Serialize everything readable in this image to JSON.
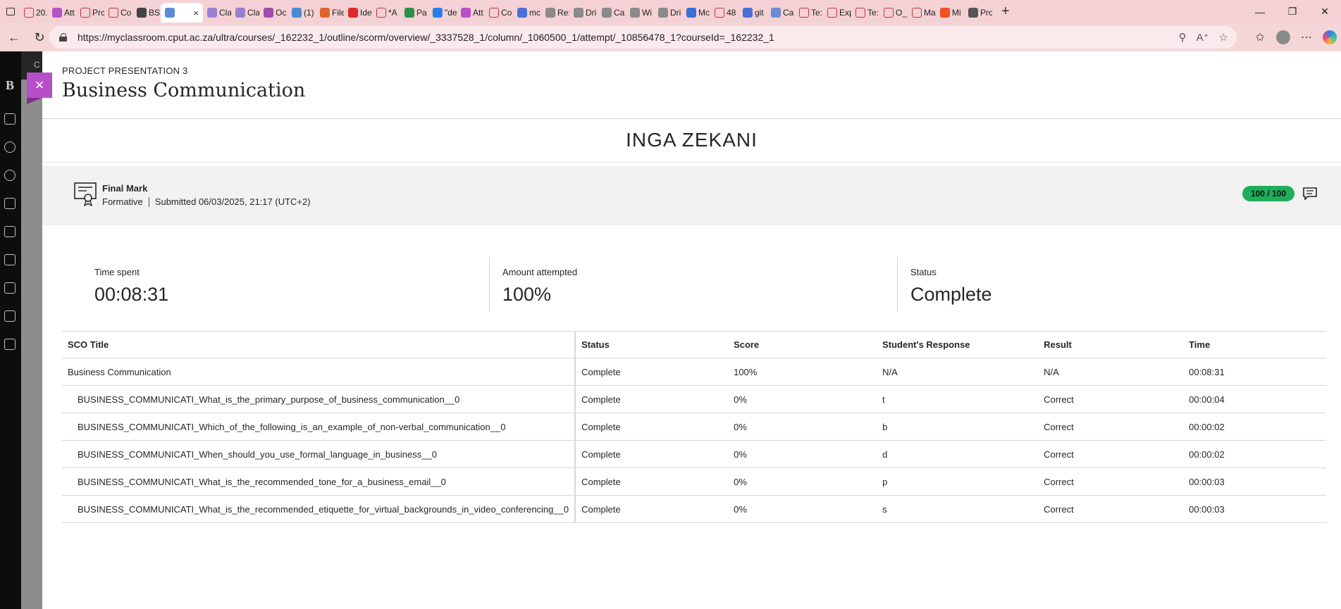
{
  "browser": {
    "tabs": [
      {
        "label": "20.",
        "icon": "pdf-icon",
        "color": "#c8323a"
      },
      {
        "label": "Att",
        "icon": "blackboard-icon",
        "color": "#b750c8"
      },
      {
        "label": "Prc",
        "icon": "pdf-icon",
        "color": "#c8323a"
      },
      {
        "label": "Co",
        "icon": "pdf-icon",
        "color": "#c8323a"
      },
      {
        "label": "BS",
        "icon": "openai-icon",
        "color": "#444444"
      },
      {
        "label": "",
        "icon": "active-tab-icon",
        "color": "#5b8bd6",
        "active": true
      },
      {
        "label": "Cla",
        "icon": "clarify-icon",
        "color": "#9a7fd1"
      },
      {
        "label": "Cla",
        "icon": "clarify-icon",
        "color": "#9a7fd1"
      },
      {
        "label": "Oc",
        "icon": "ring-icon",
        "color": "#a04ab0"
      },
      {
        "label": "(1)",
        "icon": "globe-icon",
        "color": "#4a8bd6"
      },
      {
        "label": "File",
        "icon": "gitlab-icon",
        "color": "#e2632a"
      },
      {
        "label": "Ide",
        "icon": "youtube-icon",
        "color": "#e02828"
      },
      {
        "label": "*A",
        "icon": "pdf-icon",
        "color": "#c8323a"
      },
      {
        "label": "Pa",
        "icon": "sheet-icon",
        "color": "#2f8f4a"
      },
      {
        "label": "\"de",
        "icon": "edge-icon",
        "color": "#2a7ee8"
      },
      {
        "label": "Att",
        "icon": "blackboard-icon",
        "color": "#b750c8"
      },
      {
        "label": "Co",
        "icon": "pdf-icon",
        "color": "#c8323a"
      },
      {
        "label": "mc",
        "icon": "search-icon",
        "color": "#4a6fd6"
      },
      {
        "label": "Re:",
        "icon": "wix-icon",
        "color": "#8a8a8a"
      },
      {
        "label": "Dri",
        "icon": "wix-icon",
        "color": "#8a8a8a"
      },
      {
        "label": "Ca",
        "icon": "wix-icon",
        "color": "#8a8a8a"
      },
      {
        "label": "Wi",
        "icon": "wix-icon",
        "color": "#8a8a8a"
      },
      {
        "label": "Dri",
        "icon": "wix-icon",
        "color": "#8a8a8a"
      },
      {
        "label": "Mc",
        "icon": "doc-icon",
        "color": "#3d6fd6"
      },
      {
        "label": "48",
        "icon": "pdf-icon",
        "color": "#c8323a"
      },
      {
        "label": "git",
        "icon": "search-icon",
        "color": "#4a6fd6"
      },
      {
        "label": "Ca",
        "icon": "clarify-icon",
        "color": "#6a8bd6"
      },
      {
        "label": "Te:",
        "icon": "pdf-icon",
        "color": "#c8323a"
      },
      {
        "label": "Exp",
        "icon": "pdf-icon",
        "color": "#c8323a"
      },
      {
        "label": "Te:",
        "icon": "pdf-icon",
        "color": "#c8323a"
      },
      {
        "label": "O_",
        "icon": "pdf-icon",
        "color": "#c8323a"
      },
      {
        "label": "Ma",
        "icon": "pdf-icon",
        "color": "#c8323a"
      },
      {
        "label": "Mi",
        "icon": "microsoft-icon",
        "color": "#f25022"
      },
      {
        "label": "Pro",
        "icon": "globe-icon",
        "color": "#555555"
      }
    ],
    "url": "https://myclassroom.cput.ac.za/ultra/courses/_162232_1/outline/scorm/overview/_3337528_1/column/_1060500_1/attempt/_10856478_1?courseId=_162232_1"
  },
  "background": {
    "course_letter": "B",
    "course_snippet": "C"
  },
  "panel": {
    "close_label": "×",
    "eyebrow": "PROJECT PRESENTATION 3",
    "title": "Business Communication",
    "student_name": "INGA ZEKANI",
    "final_mark": {
      "title": "Final Mark",
      "type": "Formative",
      "submitted": "Submitted 06/03/2025, 21:17 (UTC+2)",
      "score": "100 / 100"
    },
    "stats": [
      {
        "label": "Time spent",
        "value": "00:08:31"
      },
      {
        "label": "Amount attempted",
        "value": "100%"
      },
      {
        "label": "Status",
        "value": "Complete"
      }
    ],
    "table": {
      "headers": [
        "SCO Title",
        "Status",
        "Score",
        "Student's Response",
        "Result",
        "Time"
      ],
      "rows": [
        {
          "title": "Business Communication",
          "status": "Complete",
          "score": "100%",
          "response": "N/A",
          "result": "N/A",
          "time": "00:08:31"
        },
        {
          "title": "BUSINESS_COMMUNICATI_What_is_the_primary_purpose_of_business_communication__0",
          "status": "Complete",
          "score": "0%",
          "response": "t",
          "result": "Correct",
          "time": "00:00:04"
        },
        {
          "title": "BUSINESS_COMMUNICATI_Which_of_the_following_is_an_example_of_non-verbal_communication__0",
          "status": "Complete",
          "score": "0%",
          "response": "b",
          "result": "Correct",
          "time": "00:00:02"
        },
        {
          "title": "BUSINESS_COMMUNICATI_When_should_you_use_formal_language_in_business__0",
          "status": "Complete",
          "score": "0%",
          "response": "d",
          "result": "Correct",
          "time": "00:00:02"
        },
        {
          "title": "BUSINESS_COMMUNICATI_What_is_the_recommended_tone_for_a_business_email__0",
          "status": "Complete",
          "score": "0%",
          "response": "p",
          "result": "Correct",
          "time": "00:00:03"
        },
        {
          "title": "BUSINESS_COMMUNICATI_What_is_the_recommended_etiquette_for_virtual_backgrounds_in_video_conferencing__0",
          "status": "Complete",
          "score": "0%",
          "response": "s",
          "result": "Correct",
          "time": "00:00:03"
        }
      ]
    }
  },
  "colors": {
    "accent_purple": "#b750c8",
    "score_green": "#1fad5a",
    "chrome_pink": "#f3d1d4"
  }
}
